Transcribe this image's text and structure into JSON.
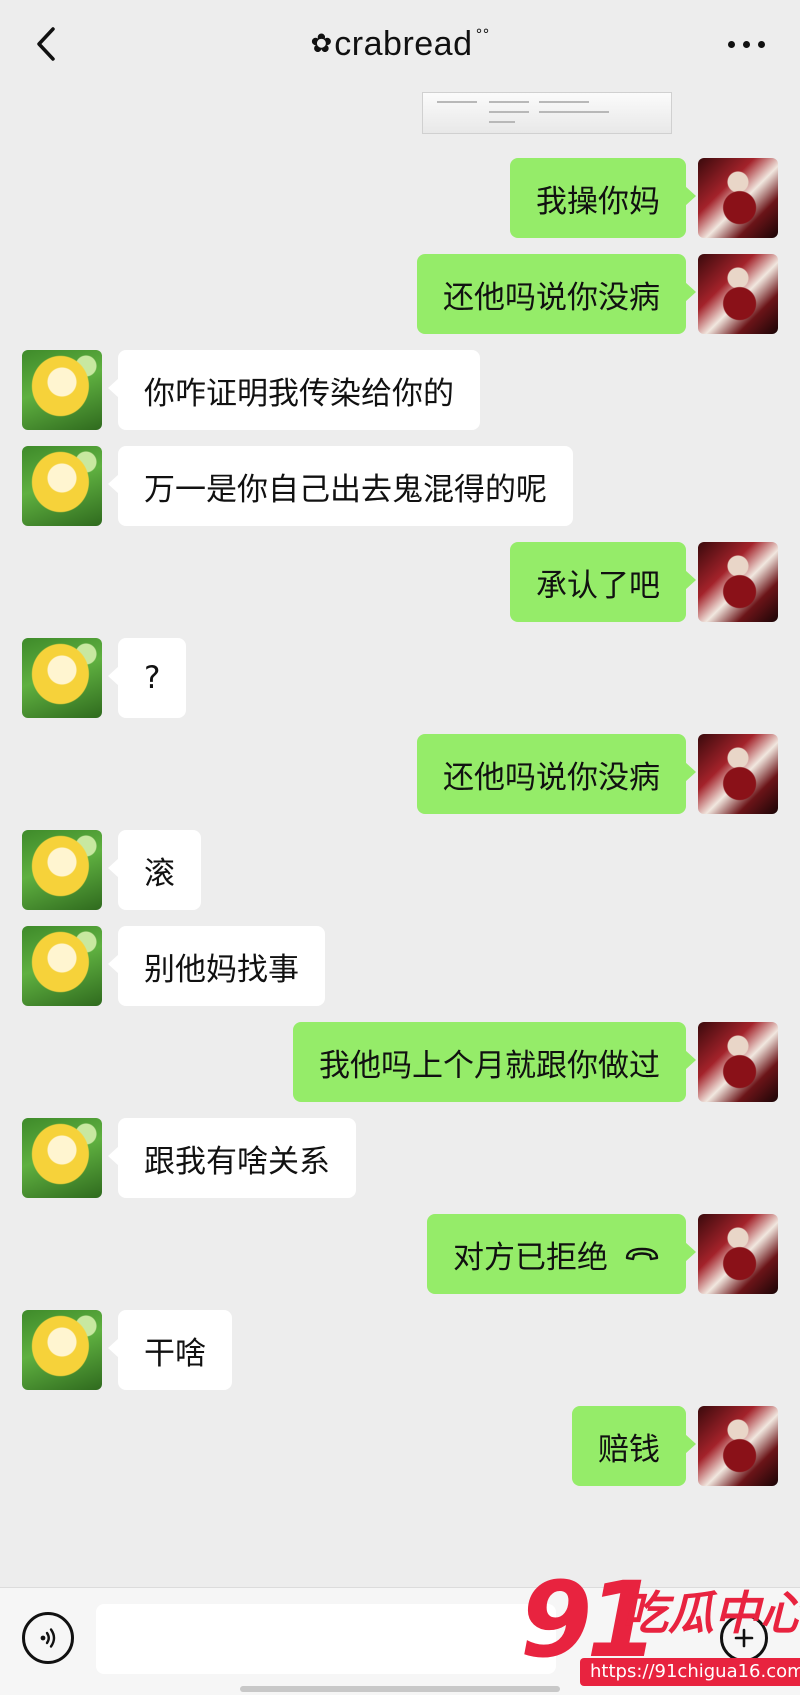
{
  "header": {
    "title": "crabread",
    "back_icon": "chevron-left-icon",
    "more_icon": "more-dots-icon"
  },
  "messages": [
    {
      "side": "right",
      "text": "我操你妈"
    },
    {
      "side": "right",
      "text": "还他吗说你没病"
    },
    {
      "side": "left",
      "text": "你咋证明我传染给你的"
    },
    {
      "side": "left",
      "text": "万一是你自己出去鬼混得的呢"
    },
    {
      "side": "right",
      "text": "承认了吧"
    },
    {
      "side": "left",
      "text": "?"
    },
    {
      "side": "right",
      "text": "还他吗说你没病"
    },
    {
      "side": "left",
      "text": "滚"
    },
    {
      "side": "left",
      "text": "别他妈找事"
    },
    {
      "side": "right",
      "text": "我他吗上个月就跟你做过"
    },
    {
      "side": "left",
      "text": "跟我有啥关系"
    },
    {
      "side": "right",
      "text": "对方已拒绝",
      "icon": "phone-hangup-icon"
    },
    {
      "side": "left",
      "text": "干啥"
    },
    {
      "side": "right",
      "text": "赔钱"
    }
  ],
  "input_bar": {
    "voice_icon": "voice-icon",
    "plus_icon": "plus-icon",
    "input_value": ""
  },
  "watermark": {
    "big_text": "91",
    "cn_text": "吃瓜中心",
    "url": "https://91chigua16.com"
  },
  "colors": {
    "background": "#ededed",
    "sent_bubble": "#95ec69",
    "received_bubble": "#ffffff",
    "watermark": "#e8233f"
  }
}
